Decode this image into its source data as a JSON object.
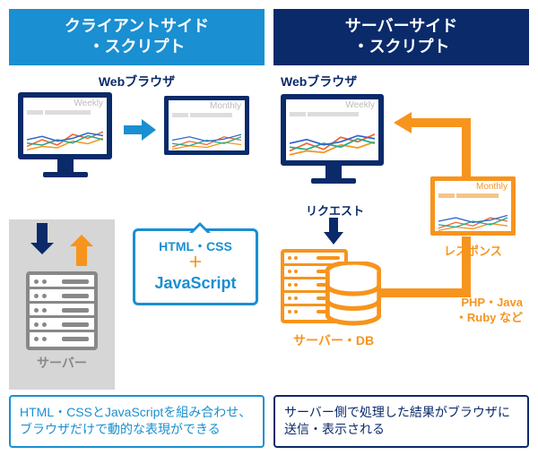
{
  "left": {
    "header_line1": "クライアントサイド",
    "header_line2": "・スクリプト",
    "browser_label": "Webブラウザ",
    "monitor_a_tag": "Weekly",
    "monitor_b_tag": "Monthly",
    "server_label": "サーバー",
    "bubble_line1": "HTML・CSS",
    "bubble_plus": "＋",
    "bubble_js": "JavaScript",
    "desc": "HTML・CSSとJavaScriptを組み合わせ、ブラウザだけで動的な表現ができる"
  },
  "right": {
    "header_line1": "サーバーサイド",
    "header_line2": "・スクリプト",
    "browser_label": "Webブラウザ",
    "monitor_tag": "Weekly",
    "request_label": "リクエスト",
    "response_label": "レスポンス",
    "monthly_tag": "Monthly",
    "lang_line1": "PHP・Java",
    "lang_line2": "・Ruby など",
    "serverdb_label": "サーバー・DB",
    "desc": "サーバー側で処理した結果がブラウザに送信・表示される"
  },
  "colors": {
    "blue_header": "#1a8fd1",
    "navy_header": "#0a2a6a",
    "orange": "#f7941d",
    "gray": "#888888"
  }
}
